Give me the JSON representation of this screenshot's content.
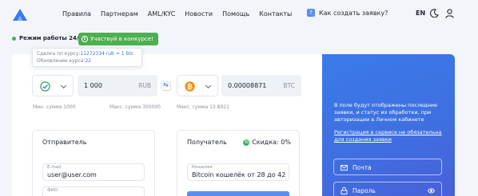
{
  "header": {
    "nav": [
      "Правила",
      "Партнерам",
      "AML/KYC",
      "Новости",
      "Помощь",
      "Контакты"
    ],
    "howto": "Как создать заявку?",
    "lang": "EN"
  },
  "status": {
    "mode": "Режим работы 24/7",
    "contest": "Участвуй в конкурсе!"
  },
  "tooltip": {
    "rate_label": "Сделка по курсу:",
    "rate_value": "11272334 rub = 1 btc",
    "update_label": "Обновление курса:",
    "update_value": "22"
  },
  "exchange": {
    "give": {
      "amount": "1 000",
      "currency": "RUB",
      "min": "Мин. сумма 1000",
      "max": "Макс. сумма 300000"
    },
    "get": {
      "amount": "0.00008871",
      "currency": "BTC",
      "max": "Макс. сумма 13.8921"
    }
  },
  "sender": {
    "title": "Отправитель",
    "email_label": "E-mail",
    "email_value": "user@user.com",
    "name_label": "ФИО"
  },
  "receiver": {
    "title": "Получатель",
    "discount": "Скидка: 0%",
    "wallet_label": "Кошелек",
    "wallet_value": "Bitcoin кошелёк от 28 до 42"
  },
  "side": {
    "info": "В поле будут отображены последние заявки, и статус их обработки, при авторизации в Личном кабинете",
    "register": "Регистрация в сервисе не обязательна для создания заявки",
    "mail_placeholder": "Почта",
    "password_placeholder": "Пароль"
  },
  "colors": {
    "accent": "#3a7bea",
    "green": "#4caf50",
    "bitcoin": "#f7931a"
  }
}
